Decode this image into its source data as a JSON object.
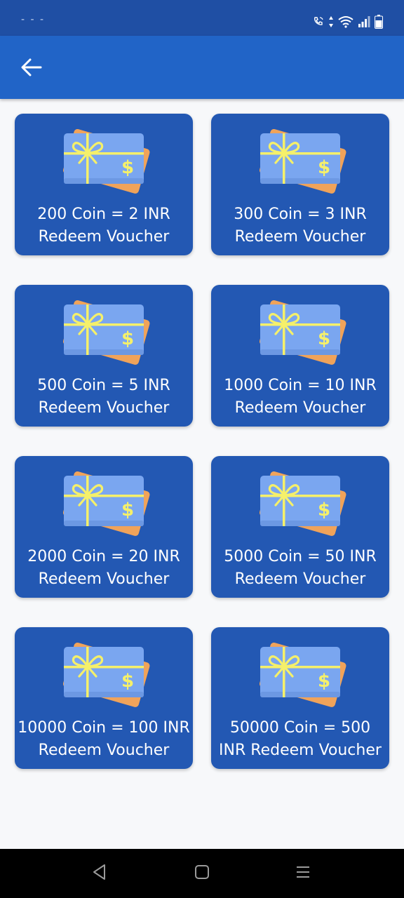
{
  "status_bar": {
    "left_text": "- - -",
    "icons": [
      "call-wifi-icon",
      "data-arrows-icon",
      "wifi-icon",
      "signal-icon",
      "battery-icon"
    ]
  },
  "app_bar": {
    "back_icon": "arrow-left-icon",
    "color": "#2164c7"
  },
  "vouchers": [
    {
      "line1": "200 Coin = 2 INR",
      "line2": "Redeem Voucher"
    },
    {
      "line1": "300 Coin = 3 INR",
      "line2": "Redeem Voucher"
    },
    {
      "line1": "500 Coin = 5 INR",
      "line2": "Redeem Voucher"
    },
    {
      "line1": "1000 Coin = 10 INR",
      "line2": "Redeem Voucher"
    },
    {
      "line1": "2000 Coin = 20 INR",
      "line2": "Redeem Voucher"
    },
    {
      "line1": "5000 Coin = 50 INR",
      "line2": "Redeem Voucher"
    },
    {
      "line1": "10000 Coin = 100 INR",
      "line2": "Redeem Voucher"
    },
    {
      "line1": "50000 Coin = 500",
      "line2": "INR Redeem Voucher"
    }
  ],
  "card_icon": "gift-card-icon",
  "colors": {
    "status_bar": "#1f4fa4",
    "card": "#2358b3",
    "gift_card_front": "#7aa6f0",
    "gift_card_back": "#f0a35a",
    "ribbon": "#f5f06a",
    "background": "#f7f8fa"
  },
  "nav_bar": {
    "buttons": [
      "back-triangle-icon",
      "home-square-icon",
      "recents-menu-icon"
    ]
  }
}
